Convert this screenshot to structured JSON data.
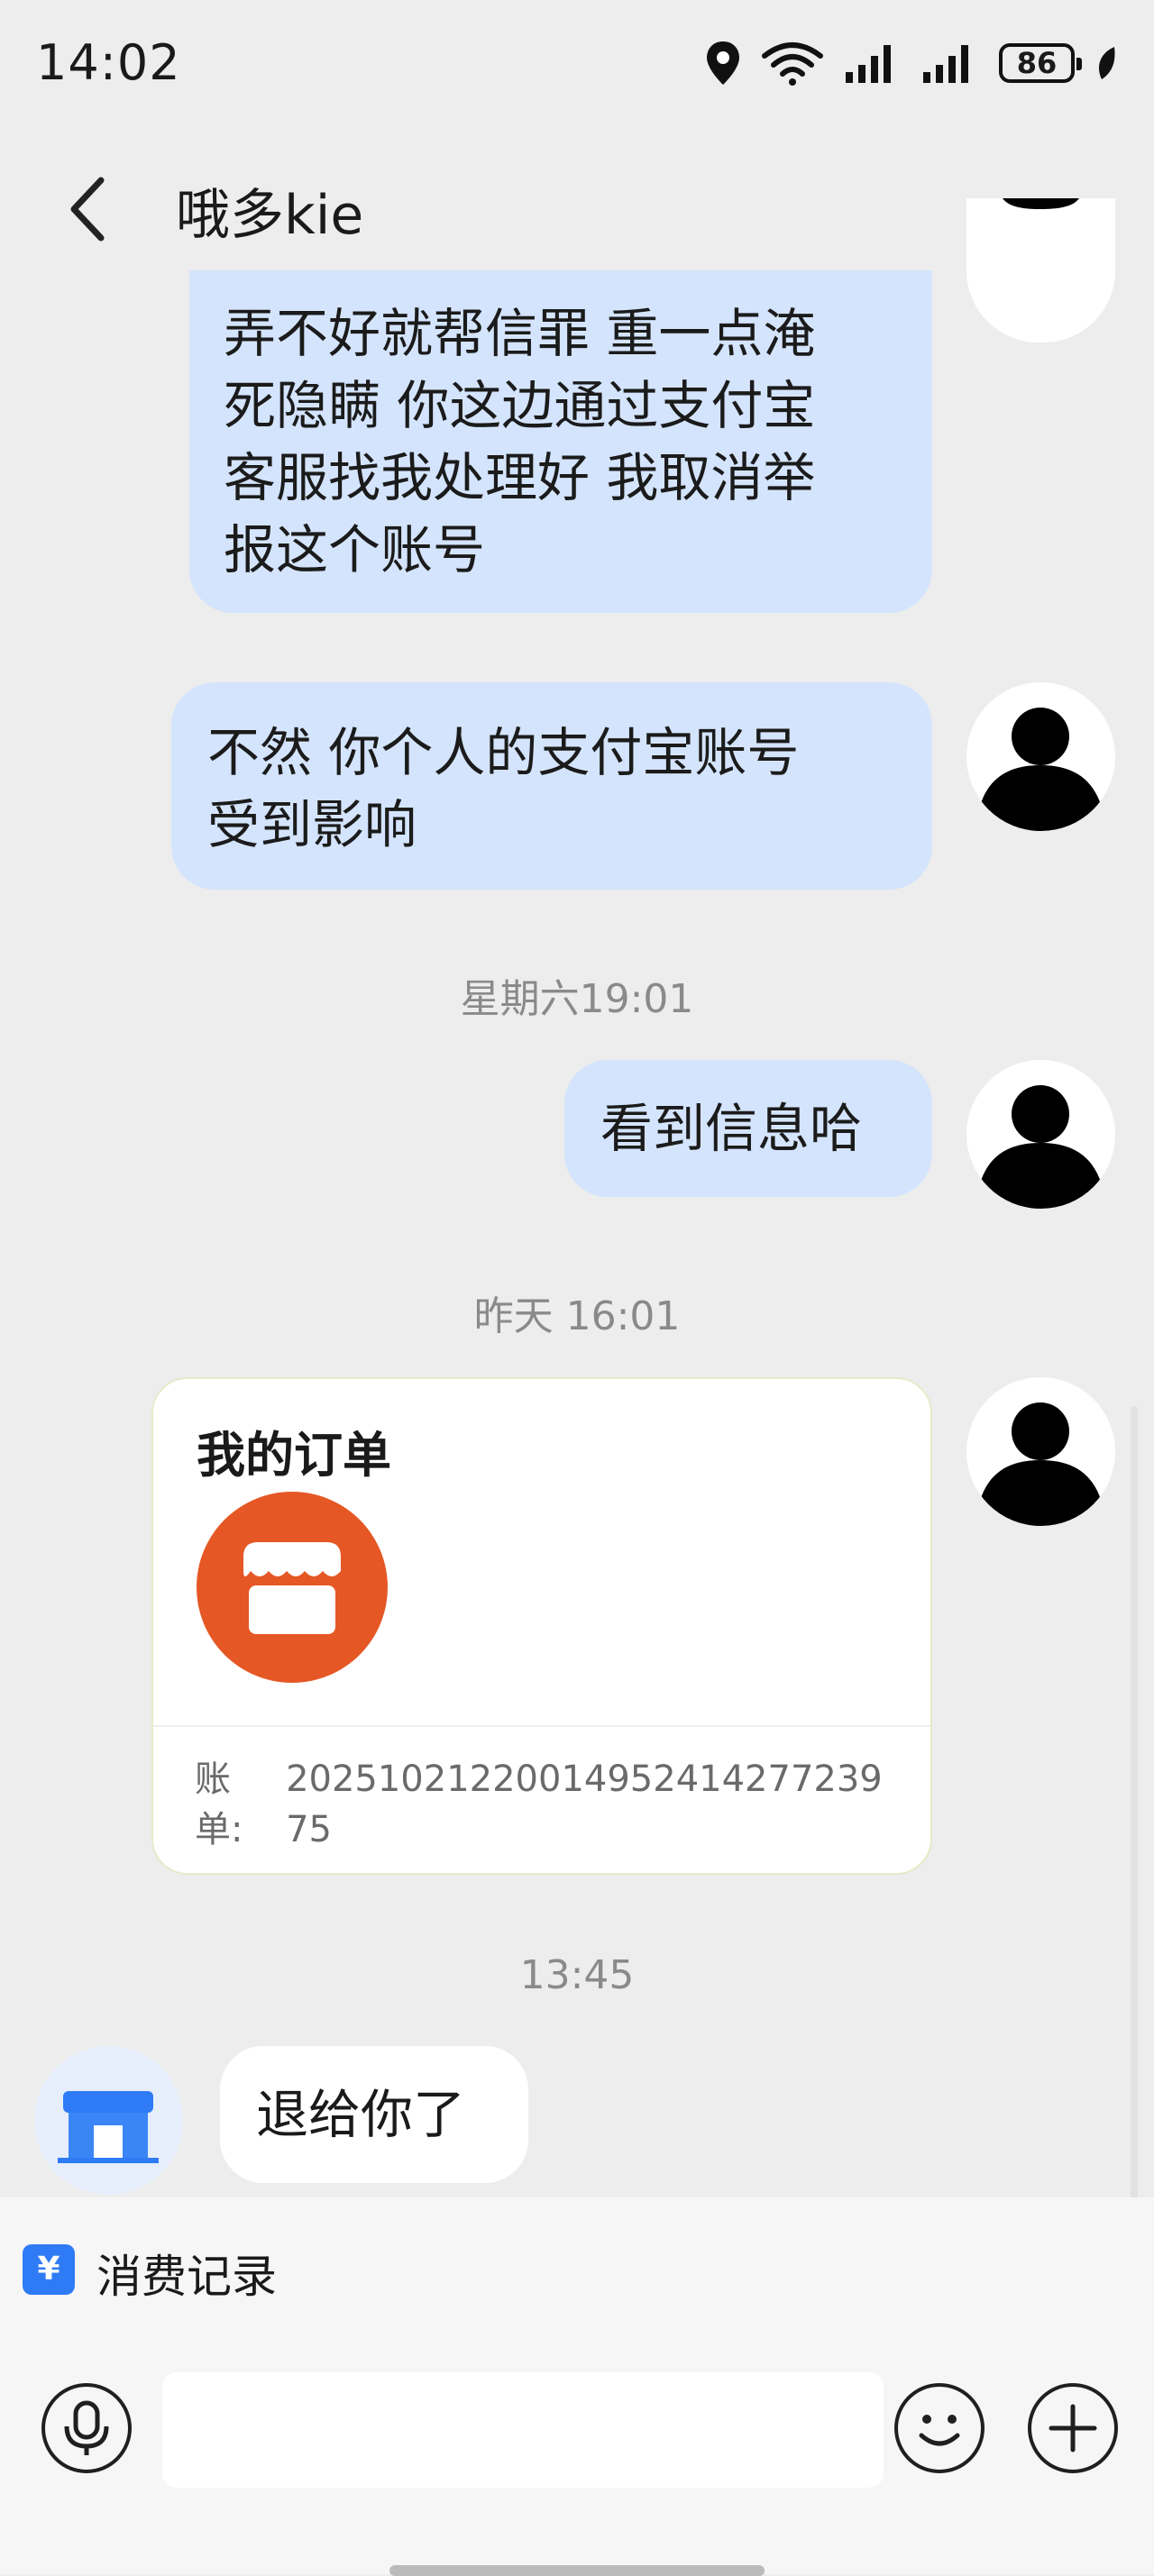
{
  "status_bar": {
    "time": "14:02",
    "battery": "86"
  },
  "header": {
    "title": "哦多kie"
  },
  "messages": {
    "m1_lines": [
      "弄不好就帮信罪 重一点淹",
      "死隐瞒 你这边通过支付宝",
      "客服找我处理好 我取消举",
      "报这个账号"
    ],
    "m2_lines": [
      "不然 你个人的支付宝账号",
      "受到影响"
    ],
    "ts1": "星期六19:01",
    "m3": "看到信息哈",
    "ts2": "昨天 16:01",
    "order_title": "我的订单",
    "order_bill_label": "账单:",
    "order_bill_number": "2025102122001495241427723975",
    "ts3": "13:45",
    "m4": "退给你了"
  },
  "bottom": {
    "record_label": "消费记录",
    "record_icon": "¥"
  },
  "colors": {
    "right_bubble": "#d4e4fc",
    "left_bubble": "#ffffff",
    "order_logo": "#e55724",
    "accent": "#2f7bf6"
  },
  "icons": [
    "location-icon",
    "wifi-icon",
    "signal-icon",
    "battery-icon",
    "leaf-icon",
    "back-icon",
    "more-icon",
    "store-icon",
    "mic-icon",
    "emoji-icon",
    "plus-icon"
  ]
}
